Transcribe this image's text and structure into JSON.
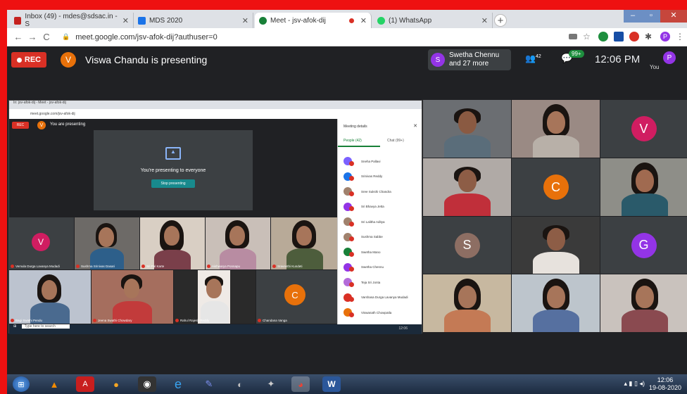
{
  "browser": {
    "tabs": [
      {
        "title": "Inbox (49) - mdes@sdsac.in - S",
        "icon_color": "#c5221f"
      },
      {
        "title": "MDS 2020",
        "icon_color": "#1a73e8"
      },
      {
        "title": "Meet - jsv-afok-dij",
        "icon_color": "#188038"
      },
      {
        "title": "(1) WhatsApp",
        "icon_color": "#25d366"
      }
    ],
    "new_tab": "+",
    "url": "meet.google.com/jsv-afok-dij?authuser=0",
    "back": "←",
    "forward": "→",
    "reload": "C"
  },
  "meet": {
    "rec_label": "REC",
    "presenter_initial": "V",
    "presenting_text": "Viswa Chandu is presenting",
    "participants_chip": {
      "initial": "S",
      "line1": "Swetha Chennu",
      "line2": "and 27 more"
    },
    "people_count": "42",
    "chat_badge": "99+",
    "time": "12:06 PM",
    "you_initial": "P",
    "you_label": "You"
  },
  "shared_screen": {
    "tab_text": "In: jsv-afok-dij - Meet - jsv-afok-dij",
    "url": "meet.google.com/jsv-afok-dij",
    "rec": "REC",
    "presenter_initial": "V",
    "you_presenting": "You are presenting",
    "presenting_to_everyone": "You're presenting to everyone",
    "stop_presenting": "Stop presenting",
    "panel_title": "Meeting details",
    "people_tab": "People (42)",
    "chat_tab": "Chat (99+)",
    "people": [
      {
        "name": "Sneha Pallavi",
        "color": "#7b61ff"
      },
      {
        "name": "Srinivas Reddy",
        "color": "#1a73e8"
      },
      {
        "name": "Sree Sukshi Chandra",
        "color": "#a0826d"
      },
      {
        "name": "Sri Bhavya Jetta",
        "color": "#9334e6"
      },
      {
        "name": "Sri Lalitha Aditya",
        "color": "#a0826d"
      },
      {
        "name": "Sushma Sabbe",
        "color": "#a0826d"
      },
      {
        "name": "Swetha Mano",
        "color": "#188038"
      },
      {
        "name": "Swetha Chennu",
        "color": "#9334e6"
      },
      {
        "name": "Teja Sri Jonta",
        "color": "#b36bd9"
      },
      {
        "name": "Varshasa Durga Lavanya Mudadi",
        "color": "#d93025"
      },
      {
        "name": "Viswanath Chowpatla",
        "color": "#e8710a"
      }
    ],
    "tiles": [
      {
        "name": "Vemula Durga Lavanya Mudadi"
      },
      {
        "name": "Sushma Srinivas Dasari"
      },
      {
        "name": "Sri Pal Karte"
      },
      {
        "name": "Aishwarya Ponnapu"
      },
      {
        "name": "Sravanthi Kundeti"
      },
      {
        "name": "Bagi Swathi Pendu"
      },
      {
        "name": "Jeena Swathi Chowdary"
      },
      {
        "name": "Rahul Rajesh Reddy"
      },
      {
        "name": "Chandana Vanga"
      }
    ],
    "tile_initials": {
      "v": "V",
      "c": "C"
    },
    "search_placeholder": "Type here to search",
    "tray_time": "12:06"
  },
  "tiles": [
    {
      "kind": "photo"
    },
    {
      "kind": "photo"
    },
    {
      "kind": "letter",
      "initial": "V",
      "color": "#d01d61"
    },
    {
      "kind": "photo"
    },
    {
      "kind": "letter",
      "initial": "C",
      "color": "#e8710a"
    },
    {
      "kind": "photo"
    },
    {
      "kind": "letter",
      "initial": "S",
      "color": "#8d6e63"
    },
    {
      "kind": "photo"
    },
    {
      "kind": "letter",
      "initial": "G",
      "color": "#9334e6"
    },
    {
      "kind": "photo"
    },
    {
      "kind": "photo"
    },
    {
      "kind": "photo"
    }
  ],
  "taskbar": {
    "clock_time": "12:06",
    "clock_date": "19-08-2020"
  }
}
